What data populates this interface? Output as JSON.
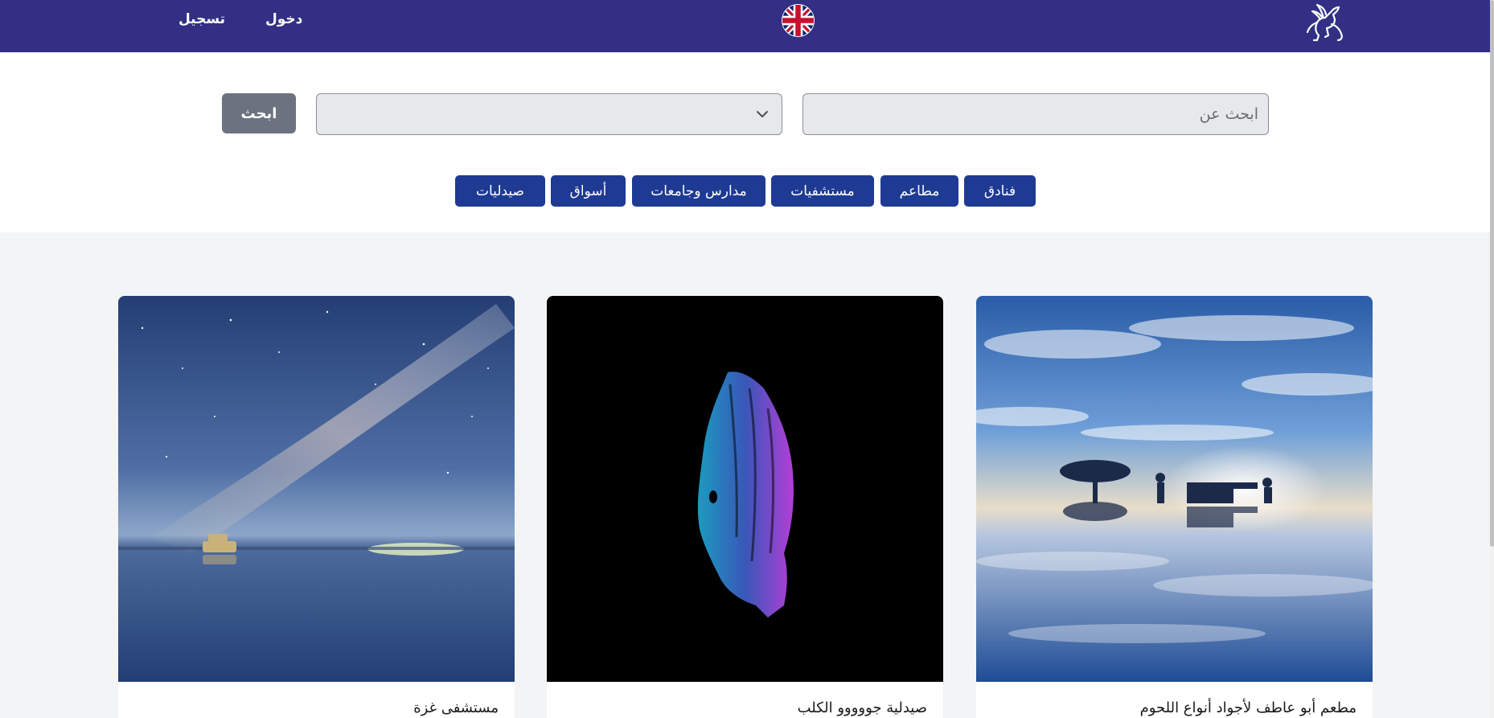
{
  "header": {
    "login_label": "دخول",
    "register_label": "تسجيل",
    "language_icon": "uk-flag-icon",
    "logo_icon": "pegasus-logo-icon",
    "background_color": "#322f85"
  },
  "search": {
    "placeholder": "ابحث عن",
    "value": "",
    "category_selected": "",
    "button_label": "ابحث"
  },
  "filters": [
    {
      "label": "فنادق"
    },
    {
      "label": "مطاعم"
    },
    {
      "label": "مستشفيات"
    },
    {
      "label": "مدارس وجامعات"
    },
    {
      "label": "أسواق"
    },
    {
      "label": "صيدليات"
    }
  ],
  "filter_color": "#1f3a93",
  "cards": [
    {
      "title": "مطعم أبو عاطف لأجواد أنواع اللحوم"
    },
    {
      "title": "صيدلية جووووو الكلب"
    },
    {
      "title": "مستشفى غزة"
    }
  ]
}
